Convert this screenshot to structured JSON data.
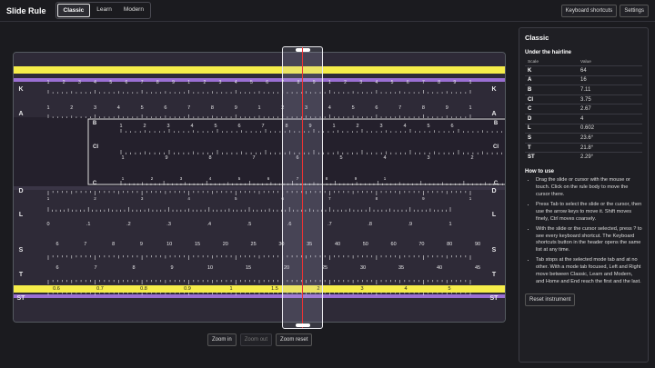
{
  "app": {
    "title": "Slide Rule"
  },
  "modes": [
    "Classic",
    "Learn",
    "Modern"
  ],
  "active_mode": "Classic",
  "header_buttons": {
    "keyboard": "Keyboard shortcuts",
    "settings": "Settings"
  },
  "zoom": {
    "in": "Zoom in",
    "out": "Zoom out",
    "reset": "Zoom reset"
  },
  "rule": {
    "labels": {
      "K": "K",
      "A": "A",
      "B": "B",
      "CI": "CI",
      "C": "C",
      "D": "D",
      "L": "L",
      "S": "S",
      "T1": "T",
      "T2": "T",
      "ST": "ST"
    },
    "K_labels": [
      "1",
      "2",
      "3",
      "4",
      "5",
      "6",
      "7",
      "8",
      "9",
      "1",
      "2",
      "3",
      "4",
      "5",
      "6",
      "7",
      "8",
      "9",
      "1",
      "2",
      "3",
      "4",
      "5",
      "6",
      "7",
      "8",
      "9",
      "1"
    ],
    "A_labels": [
      "1",
      "2",
      "3",
      "4",
      "5",
      "6",
      "7",
      "8",
      "9",
      "1",
      "2",
      "3",
      "4",
      "5",
      "6",
      "7",
      "8",
      "9",
      "1"
    ],
    "D_labels": [
      "1",
      "2",
      "3",
      "4",
      "5",
      "6",
      "7",
      "8",
      "9",
      "1"
    ],
    "L_labels": [
      "0",
      ".1",
      ".2",
      ".3",
      ".4",
      ".5",
      ".6",
      ".7",
      ".8",
      ".9",
      "1"
    ],
    "S_labels": [
      "6",
      "7",
      "8",
      "9",
      "10",
      "15",
      "20",
      "25",
      "30",
      "35",
      "40",
      "50",
      "60",
      "70",
      "80",
      "90"
    ],
    "T_labels": [
      "6",
      "7",
      "8",
      "9",
      "10",
      "15",
      "20",
      "25",
      "30",
      "35",
      "40",
      "45"
    ],
    "ST_labels": [
      "0.6",
      "0.7",
      "0.8",
      "0.9",
      "1",
      "1.5",
      "2",
      "3",
      "4",
      "5"
    ],
    "colors": {
      "body": "#2e2a37",
      "yellow": "#f6ed4a",
      "purple": "#9b6fd4",
      "slide": "#24202c",
      "ticks": "#e8e8ea"
    }
  },
  "panel": {
    "title": "Classic",
    "subtitle": "Under the hairline",
    "col_scale": "Scale",
    "col_value": "Value",
    "rows": [
      [
        "K",
        "64"
      ],
      [
        "A",
        "16"
      ],
      [
        "B",
        "7.11"
      ],
      [
        "CI",
        "3.75"
      ],
      [
        "C",
        "2.67"
      ],
      [
        "D",
        "4"
      ],
      [
        "L",
        "0.602"
      ],
      [
        "S",
        "23.6°"
      ],
      [
        "T",
        "21.8°"
      ],
      [
        "ST",
        "2.29°"
      ]
    ],
    "howto_title": "How to use",
    "howto": [
      "Drag the slide or cursor with the mouse or touch. Click on the rule body to move the cursor there.",
      "Press Tab to select the slide or the cursor, then use the arrow keys to move it. Shift moves finely, Ctrl moves coarsely.",
      "With the slide or the cursor selected, press ? to see every keyboard shortcut. The Keyboard shortcuts button in the header opens the same list at any time.",
      "Tab stops at the selected mode tab and at no other. With a mode tab focused, Left and Right move between Classic, Learn and Modern, and Home and End reach the first and the last."
    ],
    "reset": "Reset instrument"
  }
}
